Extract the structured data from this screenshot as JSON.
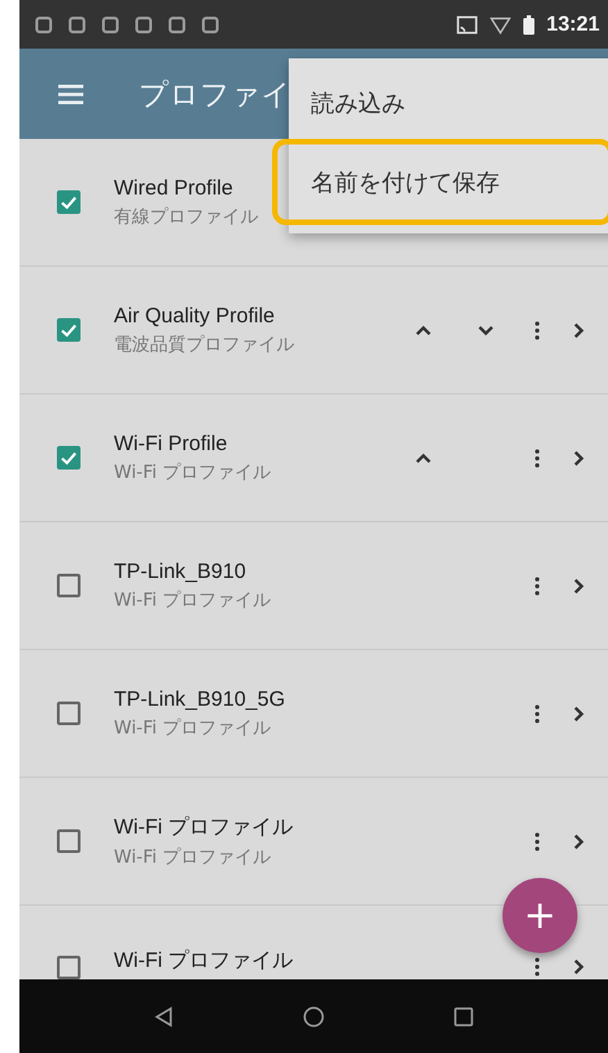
{
  "status_bar": {
    "time": "13:21"
  },
  "app_bar": {
    "title": "プロファイ"
  },
  "menu": {
    "items": [
      {
        "label": "読み込み",
        "highlighted": false
      },
      {
        "label": "名前を付けて保存",
        "highlighted": true
      }
    ]
  },
  "profiles": [
    {
      "name": "Wired Profile",
      "type": "有線プロファイル",
      "checked": true,
      "up": false,
      "down": false,
      "more": false,
      "open": false
    },
    {
      "name": "Air Quality Profile",
      "type": "電波品質プロファイル",
      "checked": true,
      "up": true,
      "down": true,
      "more": true,
      "open": true
    },
    {
      "name": "Wi-Fi Profile",
      "type": "Wi-Fi プロファイル",
      "checked": true,
      "up": true,
      "down": false,
      "more": true,
      "open": true
    },
    {
      "name": "TP-Link_B910",
      "type": "Wi-Fi プロファイル",
      "checked": false,
      "up": false,
      "down": false,
      "more": true,
      "open": true
    },
    {
      "name": "TP-Link_B910_5G",
      "type": "Wi-Fi プロファイル",
      "checked": false,
      "up": false,
      "down": false,
      "more": true,
      "open": true
    },
    {
      "name": "Wi-Fi プロファイル",
      "type": "Wi-Fi プロファイル",
      "checked": false,
      "up": false,
      "down": false,
      "more": true,
      "open": true
    },
    {
      "name": "Wi-Fi プロファイル",
      "checked": false,
      "up": false,
      "down": false,
      "more": true,
      "open": true
    }
  ],
  "fab": {
    "label": "+"
  }
}
